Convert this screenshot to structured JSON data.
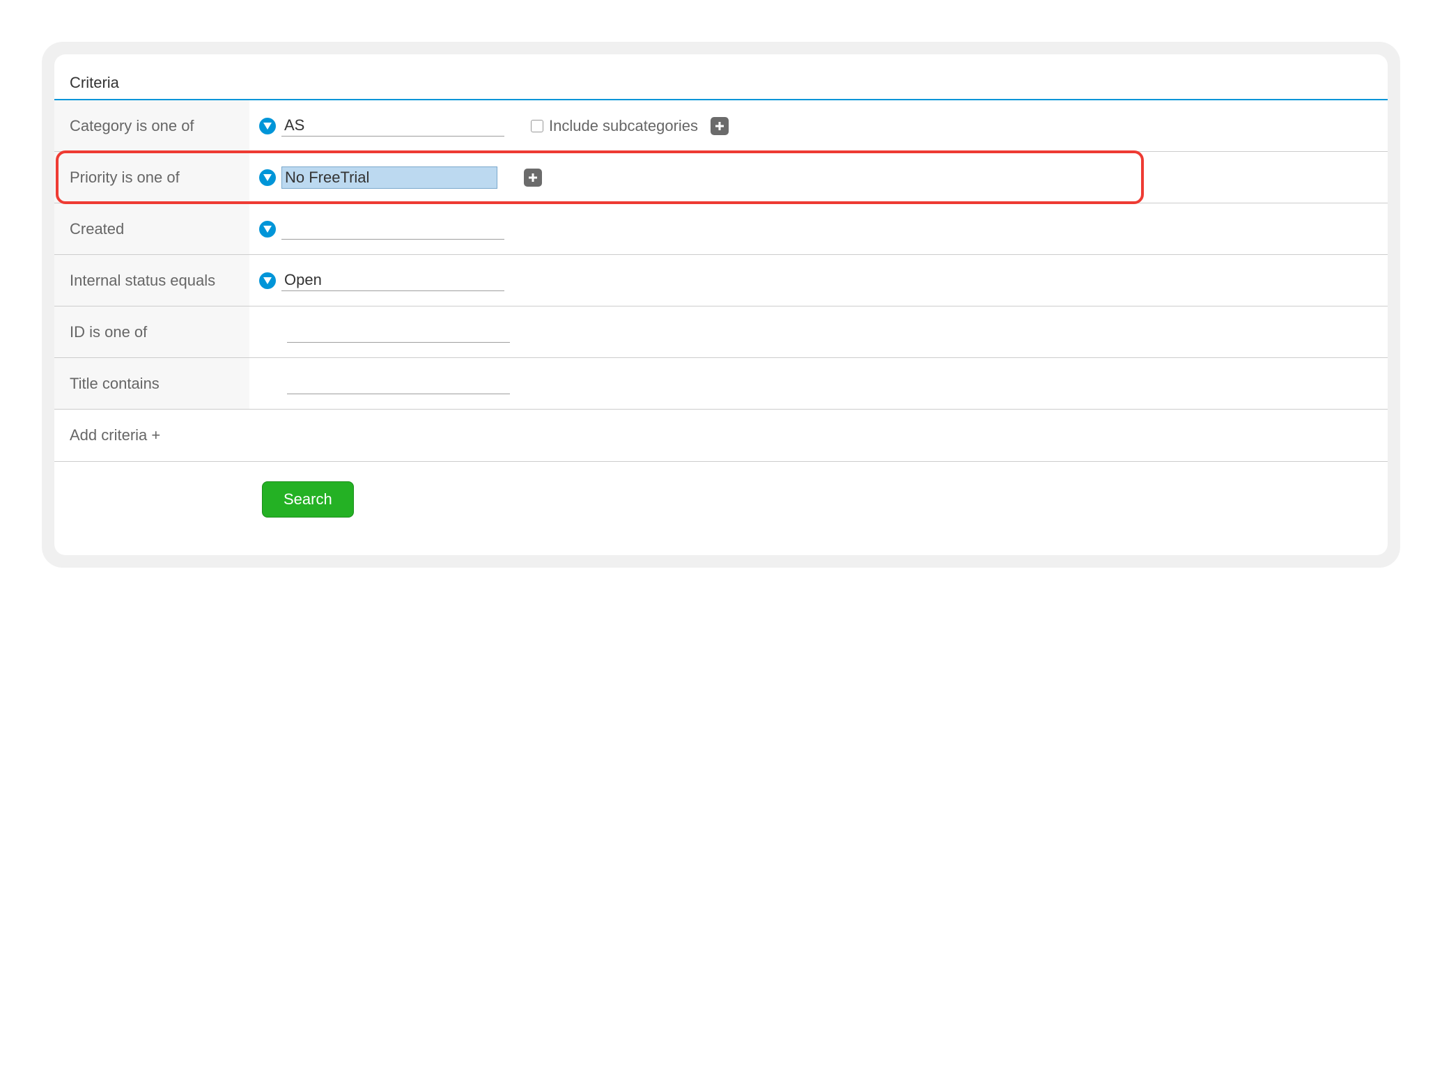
{
  "header": "Criteria",
  "rows": {
    "category": {
      "label": "Category is one of",
      "value": "AS",
      "subcat_label": "Include subcategories"
    },
    "priority": {
      "label": "Priority is one of",
      "value": "No FreeTrial"
    },
    "created": {
      "label": "Created",
      "value": ""
    },
    "internal_status": {
      "label": "Internal status equals",
      "value": "Open"
    },
    "id": {
      "label": "ID is one of",
      "value": ""
    },
    "title": {
      "label": "Title contains",
      "value": ""
    }
  },
  "add_criteria_label": "Add criteria +",
  "search_label": "Search"
}
